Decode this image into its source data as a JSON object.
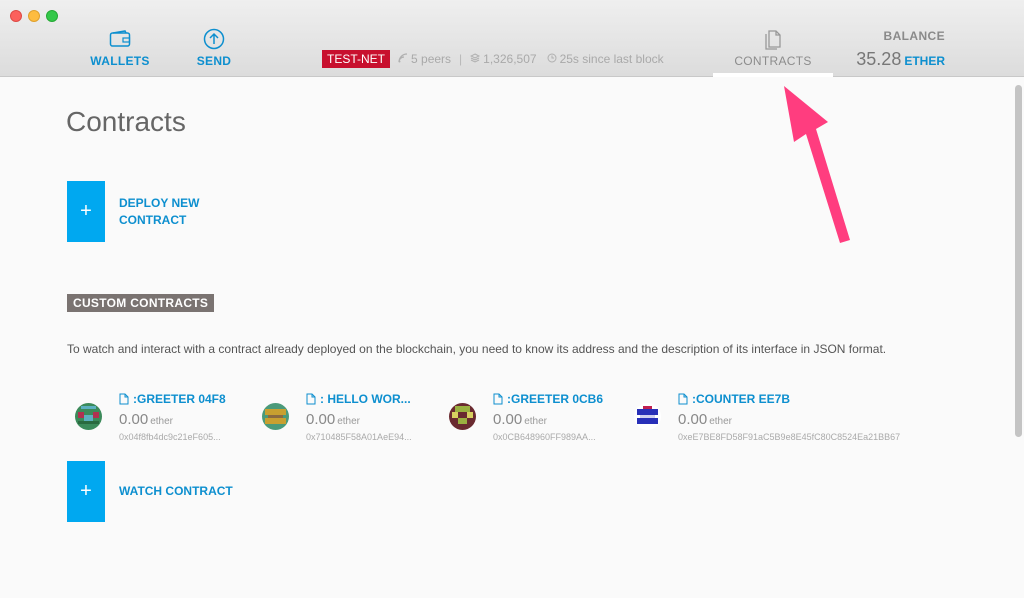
{
  "header": {
    "nav": {
      "wallets": "WALLETS",
      "send": "SEND",
      "contracts": "CONTRACTS"
    },
    "network": {
      "badge": "TEST-NET",
      "peers": "5 peers",
      "block": "1,326,507",
      "since": "25s since last block"
    },
    "balance": {
      "label": "BALANCE",
      "value": "35.28",
      "unit": "ETHER"
    }
  },
  "main": {
    "title": "Contracts",
    "deploy": {
      "plus": "+",
      "line1": "DEPLOY NEW",
      "line2": "CONTRACT"
    },
    "custom": {
      "heading": "CUSTOM CONTRACTS",
      "description": "To watch and interact with a contract already deployed on the blockchain, you need to know its address and the description of its interface in JSON format."
    },
    "contracts": [
      {
        "name": ":GREETER 04F8",
        "balance": "0.00",
        "unit": "ether",
        "address": "0x04f8fb4dc9c21eF605..."
      },
      {
        "name": ": HELLO WOR...",
        "balance": "0.00",
        "unit": "ether",
        "address": "0x710485F58A01AeE94..."
      },
      {
        "name": ":GREETER 0CB6",
        "balance": "0.00",
        "unit": "ether",
        "address": "0x0CB648960FF989AA..."
      },
      {
        "name": ":COUNTER EE7B",
        "balance": "0.00",
        "unit": "ether",
        "address": "0xeE7BE8FD58F91aC5B9e8E45fC80C8524Ea21BB67"
      }
    ],
    "watch": {
      "plus": "+",
      "label": "WATCH CONTRACT"
    }
  },
  "colors": {
    "accent": "#00a8f0",
    "link": "#0d8fcf",
    "testnet": "#c8102e",
    "annotation": "#ff3d7f"
  }
}
